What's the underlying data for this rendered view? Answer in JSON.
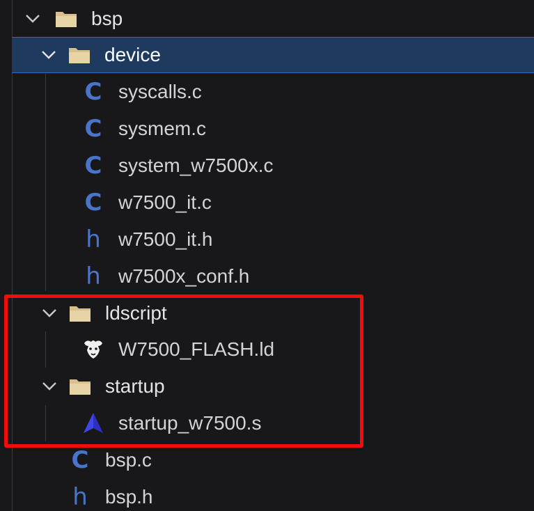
{
  "tree": {
    "root": {
      "label": "bsp",
      "icon": "folder-open-icon",
      "expanded": true
    },
    "device": {
      "label": "device",
      "icon": "folder-open-icon",
      "expanded": true,
      "selected": true
    },
    "device_files": [
      {
        "label": "syscalls.c",
        "icon": "c-file-icon",
        "glyph": "C"
      },
      {
        "label": "sysmem.c",
        "icon": "c-file-icon",
        "glyph": "C"
      },
      {
        "label": "system_w7500x.c",
        "icon": "c-file-icon",
        "glyph": "C"
      },
      {
        "label": "w7500_it.c",
        "icon": "c-file-icon",
        "glyph": "C"
      },
      {
        "label": "w7500_it.h",
        "icon": "h-file-icon",
        "glyph": "h"
      },
      {
        "label": "w7500x_conf.h",
        "icon": "h-file-icon",
        "glyph": "h"
      }
    ],
    "ldscript": {
      "label": "ldscript",
      "icon": "folder-open-icon",
      "expanded": true
    },
    "ldscript_files": [
      {
        "label": "W7500_FLASH.ld",
        "icon": "gnu-linker-icon"
      }
    ],
    "startup": {
      "label": "startup",
      "icon": "folder-open-icon",
      "expanded": true
    },
    "startup_files": [
      {
        "label": "startup_w7500.s",
        "icon": "assembly-file-icon"
      }
    ],
    "root_files": [
      {
        "label": "bsp.c",
        "icon": "c-file-icon",
        "glyph": "C"
      },
      {
        "label": "bsp.h",
        "icon": "h-file-icon",
        "glyph": "h"
      }
    ]
  },
  "colors": {
    "background": "#18181b",
    "selection": "#1f3a5f",
    "selection_border": "#2e6bc7",
    "c_icon": "#4a74c9",
    "folder": "#d7bf8e",
    "highlight_box": "#f20d0d"
  }
}
